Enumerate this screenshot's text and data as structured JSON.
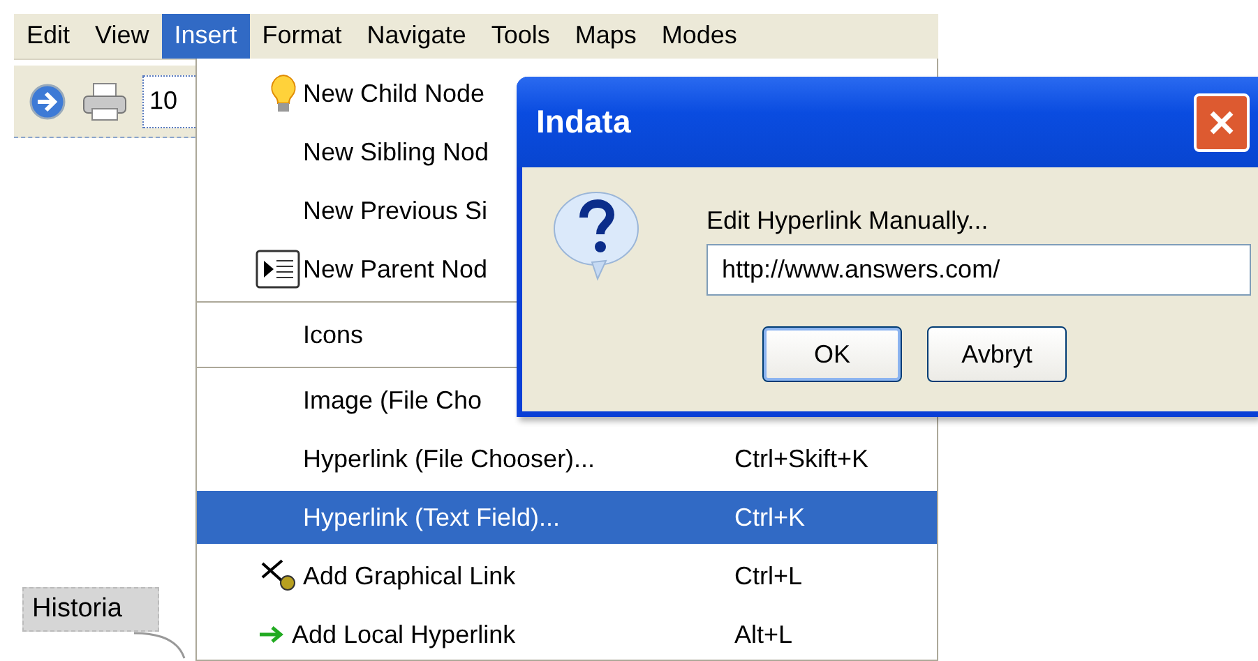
{
  "menubar": [
    {
      "label": "Edit",
      "selected": false
    },
    {
      "label": "View",
      "selected": false
    },
    {
      "label": "Insert",
      "selected": true
    },
    {
      "label": "Format",
      "selected": false
    },
    {
      "label": "Navigate",
      "selected": false
    },
    {
      "label": "Tools",
      "selected": false
    },
    {
      "label": "Maps",
      "selected": false
    },
    {
      "label": "Modes",
      "selected": false
    }
  ],
  "toolbar": {
    "zoom_field": {
      "value": "10"
    }
  },
  "menu": [
    {
      "kind": "bulb",
      "label": "New Child Node",
      "selected": false
    },
    {
      "kind": "plain",
      "label": "New Sibling Nod",
      "selected": false
    },
    {
      "kind": "plain",
      "label": "New Previous Si",
      "selected": false
    },
    {
      "kind": "outline",
      "label": "New Parent Nod",
      "selected": false
    },
    {
      "kind": "separator"
    },
    {
      "kind": "plain",
      "label": "Icons",
      "selected": false
    },
    {
      "kind": "separator"
    },
    {
      "kind": "plain",
      "label": "Image (File Cho",
      "selected": false
    },
    {
      "kind": "plain",
      "label": "Hyperlink (File Chooser)...",
      "shortcut": "Ctrl+Skift+K",
      "selected": false
    },
    {
      "kind": "plain",
      "label": "Hyperlink (Text Field)...",
      "shortcut": "Ctrl+K",
      "selected": true
    },
    {
      "kind": "pointer",
      "label": "Add Graphical Link",
      "shortcut": "Ctrl+L",
      "selected": false
    },
    {
      "kind": "arrow",
      "label": "Add Local Hyperlink",
      "shortcut": "Alt+L",
      "selected": false
    }
  ],
  "dialog": {
    "title": "Indata",
    "message": "Edit Hyperlink Manually...",
    "field": {
      "value": "http://www.answers.com/"
    },
    "buttons": [
      {
        "label": "OK",
        "default": true
      },
      {
        "label": "Avbryt",
        "default": false
      }
    ]
  },
  "map": {
    "node": "Historia"
  }
}
